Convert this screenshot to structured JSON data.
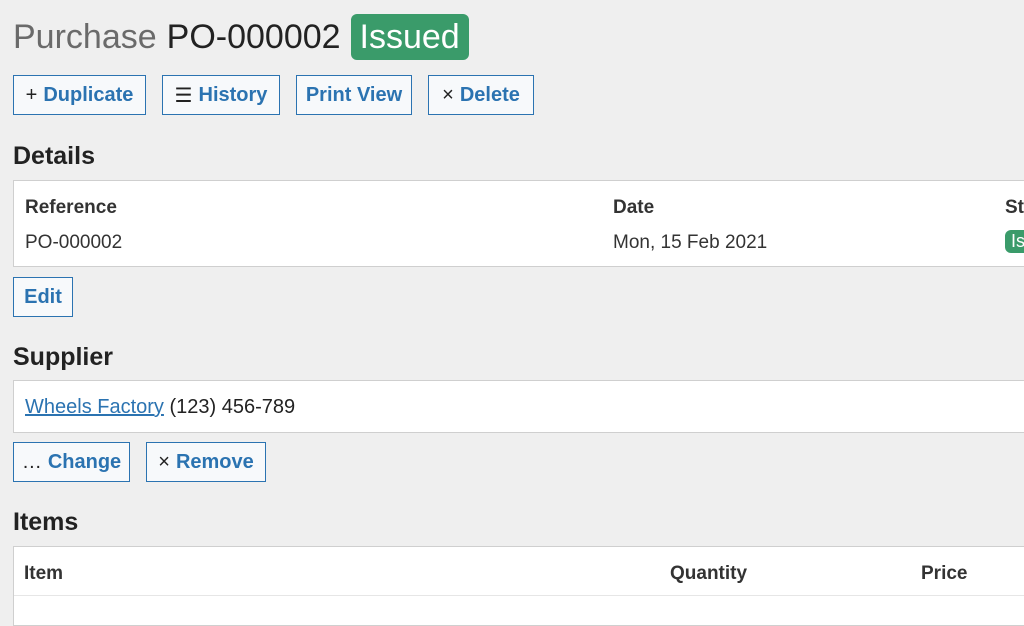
{
  "header": {
    "title_prefix": "Purchase",
    "reference": "PO-000002",
    "status": "Issued",
    "status_color": "#3a9b6a"
  },
  "toolbar": {
    "duplicate": {
      "glyph": "+",
      "label": "Duplicate"
    },
    "history": {
      "glyph": "☰",
      "label": "History"
    },
    "print": {
      "label": "Print View"
    },
    "delete": {
      "glyph": "×",
      "label": "Delete"
    }
  },
  "details": {
    "title": "Details",
    "reference_label": "Reference",
    "reference_value": "PO-000002",
    "date_label": "Date",
    "date_value": "Mon, 15 Feb 2021",
    "status_label": "Status",
    "status_value": "Issued",
    "edit_label": "Edit"
  },
  "supplier": {
    "title": "Supplier",
    "name": "Wheels Factory",
    "phone": "(123) 456-789",
    "change": {
      "glyph": "…",
      "label": "Change"
    },
    "remove": {
      "glyph": "×",
      "label": "Remove"
    }
  },
  "items": {
    "title": "Items",
    "columns": [
      "Item",
      "Quantity",
      "Price"
    ]
  },
  "colors": {
    "accent": "#2b73b1",
    "success": "#3a9b6a",
    "background": "#efefef"
  }
}
